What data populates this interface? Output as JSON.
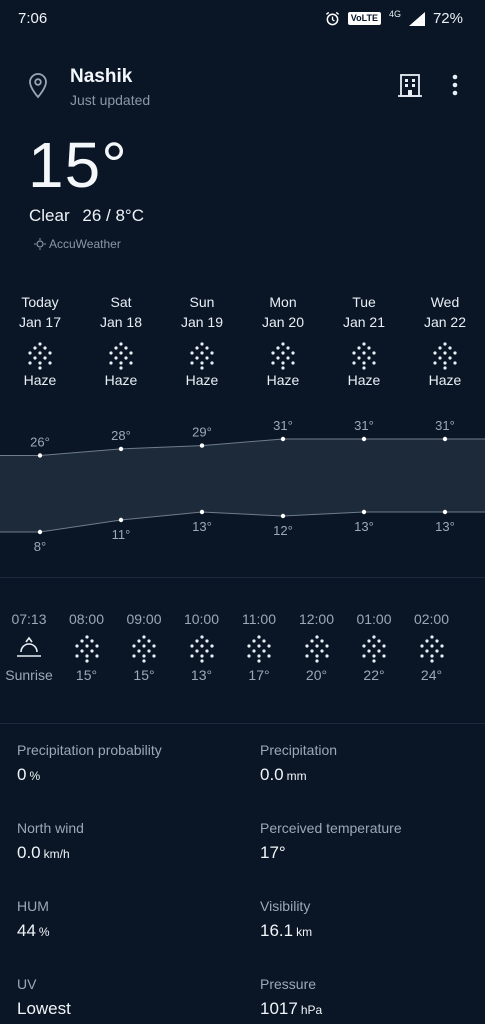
{
  "status_bar": {
    "time": "7:06",
    "network": "VoLTE",
    "signal": "4G",
    "battery": "72%"
  },
  "header": {
    "city": "Nashik",
    "updated": "Just updated"
  },
  "current": {
    "temp": "15°",
    "condition": "Clear",
    "range": "26 / 8°C",
    "provider": "AccuWeather"
  },
  "daily": [
    {
      "name": "Today",
      "date": "Jan 17",
      "condition": "Haze",
      "high": "26°",
      "low": "8°"
    },
    {
      "name": "Sat",
      "date": "Jan 18",
      "condition": "Haze",
      "high": "28°",
      "low": "11°"
    },
    {
      "name": "Sun",
      "date": "Jan 19",
      "condition": "Haze",
      "high": "29°",
      "low": "13°"
    },
    {
      "name": "Mon",
      "date": "Jan 20",
      "condition": "Haze",
      "high": "31°",
      "low": "12°"
    },
    {
      "name": "Tue",
      "date": "Jan 21",
      "condition": "Haze",
      "high": "31°",
      "low": "13°"
    },
    {
      "name": "Wed",
      "date": "Jan 22",
      "condition": "Haze",
      "high": "31°",
      "low": "13°"
    }
  ],
  "chart_data": {
    "type": "area",
    "categories": [
      "Today",
      "Sat",
      "Sun",
      "Mon",
      "Tue",
      "Wed"
    ],
    "series": [
      {
        "values": [
          26,
          28,
          29,
          31,
          31,
          31
        ]
      },
      {
        "values": [
          8,
          11,
          13,
          12,
          13,
          13
        ]
      }
    ]
  },
  "hourly": [
    {
      "time": "07:13",
      "value": "Sunrise",
      "kind": "sunrise"
    },
    {
      "time": "08:00",
      "value": "15°",
      "kind": "haze"
    },
    {
      "time": "09:00",
      "value": "15°",
      "kind": "haze"
    },
    {
      "time": "10:00",
      "value": "13°",
      "kind": "haze"
    },
    {
      "time": "11:00",
      "value": "17°",
      "kind": "haze"
    },
    {
      "time": "12:00",
      "value": "20°",
      "kind": "haze"
    },
    {
      "time": "01:00",
      "value": "22°",
      "kind": "haze"
    },
    {
      "time": "02:00",
      "value": "24°",
      "kind": "haze"
    }
  ],
  "details": [
    {
      "label": "Precipitation probability",
      "value": "0",
      "unit": "%"
    },
    {
      "label": "Precipitation",
      "value": "0.0",
      "unit": "mm"
    },
    {
      "label": "North wind",
      "value": "0.0",
      "unit": "km/h"
    },
    {
      "label": "Perceived temperature",
      "value": "17°",
      "unit": ""
    },
    {
      "label": "HUM",
      "value": "44",
      "unit": "%"
    },
    {
      "label": "Visibility",
      "value": "16.1",
      "unit": "km"
    },
    {
      "label": "UV",
      "value": "Lowest",
      "unit": ""
    },
    {
      "label": "Pressure",
      "value": "1017",
      "unit": "hPa"
    }
  ]
}
